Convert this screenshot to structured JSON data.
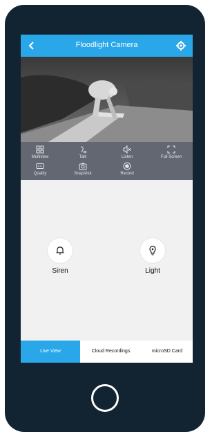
{
  "header": {
    "title": "Floodlight Camera",
    "back_icon": "chevron-left-icon",
    "settings_icon": "gear-icon"
  },
  "colors": {
    "accent": "#29a7e9",
    "phone_frame": "#122431",
    "control_bar": "#626772"
  },
  "controls": [
    {
      "label": "Multiview",
      "icon": "grid-icon"
    },
    {
      "label": "Talk",
      "icon": "talk-icon"
    },
    {
      "label": "Listen",
      "icon": "speaker-mute-icon"
    },
    {
      "label": "Full Screen",
      "icon": "fullscreen-icon"
    },
    {
      "label": "Quality",
      "icon": "hd-icon"
    },
    {
      "label": "Snapshot",
      "icon": "camera-icon"
    },
    {
      "label": "Record",
      "icon": "record-icon"
    }
  ],
  "actions": [
    {
      "label": "Siren",
      "icon": "bell-icon"
    },
    {
      "label": "Light",
      "icon": "light-bulb-icon"
    }
  ],
  "tabs": [
    {
      "label": "Live View",
      "active": true
    },
    {
      "label": "Cloud Recordings",
      "active": false
    },
    {
      "label": "microSD Card",
      "active": false
    }
  ]
}
